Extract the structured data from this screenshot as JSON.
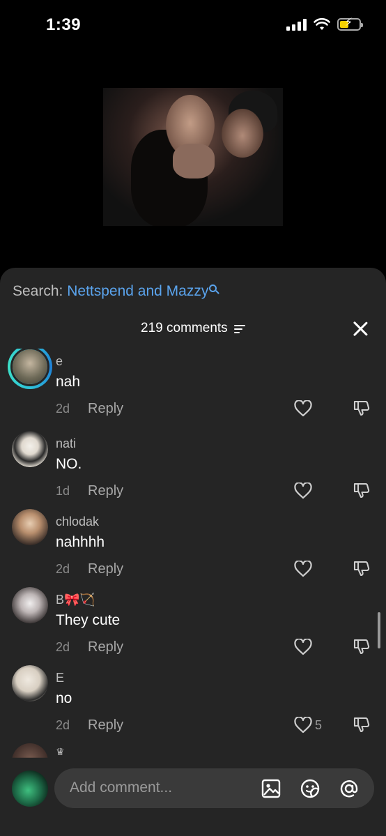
{
  "status_bar": {
    "time": "1:39"
  },
  "search": {
    "label": "Search: ",
    "query": "Nettspend and Mazzy"
  },
  "header": {
    "comment_count": "219 comments"
  },
  "comments": [
    {
      "username": "e",
      "text": "nah",
      "age": "2d",
      "reply_label": "Reply",
      "likes": "",
      "story_ring": true,
      "avatar_color": "#8d8a7a"
    },
    {
      "username": "nati",
      "text": "NO.",
      "age": "1d",
      "reply_label": "Reply",
      "likes": "",
      "story_ring": false,
      "avatar_color": "#d9d2c6"
    },
    {
      "username": "chlodak",
      "text": "nahhhh",
      "age": "2d",
      "reply_label": "Reply",
      "likes": "",
      "story_ring": false,
      "avatar_color": "#b9a48e"
    },
    {
      "username": "B🎀🏹",
      "text": "They cute",
      "age": "2d",
      "reply_label": "Reply",
      "likes": "",
      "story_ring": false,
      "avatar_color": "#cfc9c8"
    },
    {
      "username": "E",
      "text": "no",
      "age": "2d",
      "reply_label": "Reply",
      "likes": "5",
      "story_ring": false,
      "avatar_color": "#d8d3cc"
    }
  ],
  "partial_comment": {
    "username": "♛"
  },
  "composer": {
    "placeholder": "Add comment..."
  },
  "icons": {
    "sort": "sort-lines-icon",
    "close": "close-icon",
    "like": "heart-outline-icon",
    "dislike": "thumbs-down-icon",
    "image": "image-icon",
    "sticker": "sticker-icon",
    "mention": "at-mention-icon"
  },
  "colors": {
    "accent": "#5aa3ec",
    "sheet_bg": "#252525",
    "story_ring": "#2ec2d9",
    "battery": "#f5d100"
  }
}
